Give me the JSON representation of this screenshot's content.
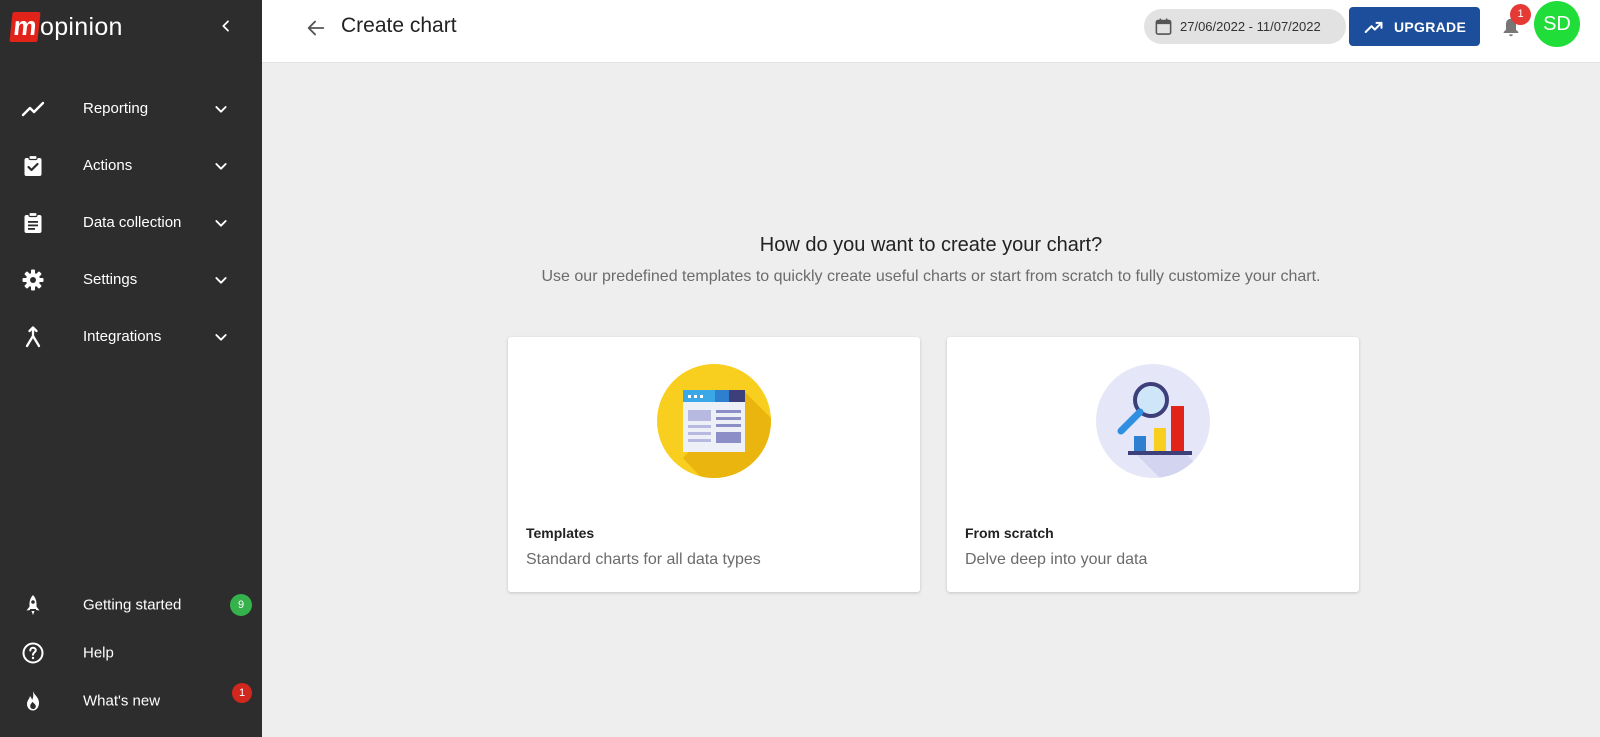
{
  "app": {
    "logo_letter": "m",
    "logo_text": "opinion"
  },
  "sidebar": {
    "items": [
      {
        "label": "Reporting",
        "icon": "trend-line-icon"
      },
      {
        "label": "Actions",
        "icon": "clipboard-check-icon"
      },
      {
        "label": "Data collection",
        "icon": "clipboard-list-icon"
      },
      {
        "label": "Settings",
        "icon": "gear-icon"
      },
      {
        "label": "Integrations",
        "icon": "merge-icon"
      }
    ],
    "bottom_items": [
      {
        "label": "Getting started",
        "icon": "rocket-icon",
        "badge": "9"
      },
      {
        "label": "Help",
        "icon": "help-circle-icon"
      },
      {
        "label": "What's new",
        "icon": "fire-icon",
        "badge": "1"
      }
    ]
  },
  "header": {
    "title": "Create chart",
    "date_range": "27/06/2022 - 11/07/2022",
    "upgrade_label": "UPGRADE",
    "notification_count": "1",
    "avatar_initials": "SD"
  },
  "main": {
    "heading": "How do you want to create your chart?",
    "subheading": "Use our predefined templates to quickly create useful charts or start from scratch to fully customize your chart.",
    "cards": [
      {
        "title": "Templates",
        "description": "Standard charts for all data types",
        "icon": "template-illustration-icon"
      },
      {
        "title": "From scratch",
        "description": "Delve deep into your data",
        "icon": "magnifier-chart-illustration-icon"
      }
    ]
  },
  "colors": {
    "sidebar_bg": "#2d2d2d",
    "brand_red": "#e2231a",
    "upgrade_blue": "#1d4e9b",
    "avatar_green": "#20dd3a",
    "badge_green": "#35b24b",
    "badge_red": "#e53935"
  }
}
